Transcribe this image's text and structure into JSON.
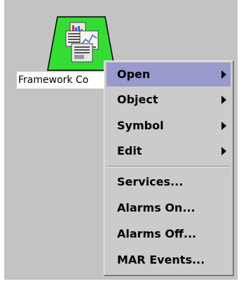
{
  "node": {
    "label": "Framework Co",
    "icon": "framework-controller-icon",
    "status_color": "#33dd33"
  },
  "context_menu": {
    "highlight_color": "#9999cc",
    "items": [
      {
        "label": "Open",
        "has_submenu": true,
        "selected": true
      },
      {
        "label": "Object",
        "has_submenu": true
      },
      {
        "label": "Symbol",
        "has_submenu": true
      },
      {
        "label": "Edit",
        "has_submenu": true
      },
      {
        "label": "Services...",
        "has_submenu": false
      },
      {
        "label": "Alarms On...",
        "has_submenu": false
      },
      {
        "label": "Alarms Off...",
        "has_submenu": false
      },
      {
        "label": "MAR Events...",
        "has_submenu": false
      }
    ]
  }
}
